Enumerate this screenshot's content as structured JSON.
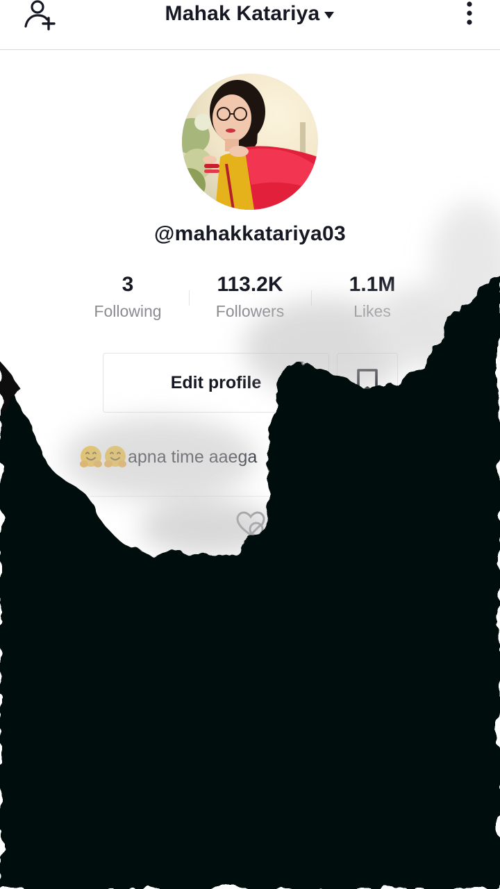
{
  "header": {
    "title": "Mahak Katariya",
    "icons": {
      "add_user": "add-user-icon",
      "dropdown": "caret-down-icon",
      "more": "more-vertical-icon"
    }
  },
  "profile": {
    "username": "@mahakkatariya03",
    "stats": [
      {
        "value": "3",
        "label": "Following"
      },
      {
        "value": "113.2K",
        "label": "Followers"
      },
      {
        "value": "1.1M",
        "label": "Likes"
      }
    ],
    "edit_button_label": "Edit profile",
    "bookmark_icon": "bookmark-icon",
    "bio": "apna time aaega"
  },
  "tabs": {
    "liked_icon": "liked-videos-icon"
  },
  "colors": {
    "text_primary": "#161823",
    "text_secondary": "#8a8b91",
    "border": "#e3e3e4",
    "overlay": "#050807"
  }
}
